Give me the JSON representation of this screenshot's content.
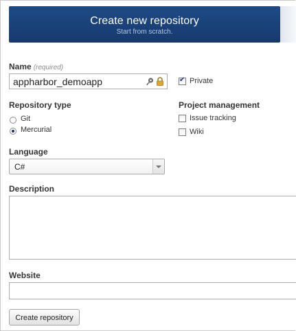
{
  "header": {
    "title": "Create new repository",
    "subtitle": "Start from scratch."
  },
  "name_field": {
    "label": "Name",
    "hint": "(required)",
    "value": "appharbor_demoapp",
    "icons": [
      "key-icon",
      "lock-icon"
    ]
  },
  "private_option": {
    "label": "Private",
    "checked": true
  },
  "repository_type": {
    "label": "Repository type",
    "options": [
      {
        "label": "Git",
        "selected": false
      },
      {
        "label": "Mercurial",
        "selected": true
      }
    ]
  },
  "project_management": {
    "label": "Project management",
    "options": [
      {
        "label": "Issue tracking",
        "checked": false
      },
      {
        "label": "Wiki",
        "checked": false
      }
    ]
  },
  "language": {
    "label": "Language",
    "value": "C#"
  },
  "description": {
    "label": "Description",
    "value": ""
  },
  "website": {
    "label": "Website",
    "value": ""
  },
  "submit": {
    "label": "Create repository"
  },
  "colors": {
    "header_background": "#1a437a",
    "label_text": "#333333"
  }
}
